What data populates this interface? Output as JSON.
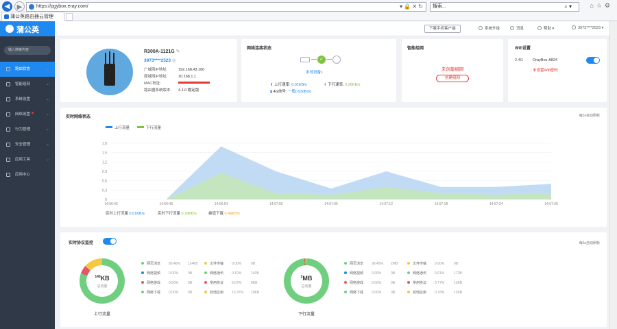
{
  "browser": {
    "url": "https://pgybox.eray.com/",
    "search_placeholder": "搜索...",
    "tab_title": "蒲公英路由器云管理"
  },
  "sidebar": {
    "logo": "蒲公英",
    "search_placeholder": "输入搜索内容",
    "items": [
      {
        "label": "路由状态",
        "active": true
      },
      {
        "label": "智能组网"
      },
      {
        "label": "系统设置"
      },
      {
        "label": "网络设置",
        "dot": true
      },
      {
        "label": "行为管理"
      },
      {
        "label": "安全管理"
      },
      {
        "label": "应用工具"
      },
      {
        "label": "应用中心"
      }
    ]
  },
  "topbar": {
    "download": "下载手机客户端",
    "upgrade": "系统升级",
    "announcement": "消息",
    "help": "帮助",
    "account": "3973****2523"
  },
  "device": {
    "name": "R300A-1121G",
    "account": "3973****2523",
    "rows": [
      {
        "k": "广域网IP地址:",
        "v": "192.168.43.100"
      },
      {
        "k": "局域网IP地址:",
        "v": "10.168.1.1"
      },
      {
        "k": "MAC地址:",
        "v": ""
      },
      {
        "k": "路由器系统版本:",
        "v": "4.1.0 稳定版"
      }
    ]
  },
  "network": {
    "title": "网络连接状态",
    "device_label": "本地设备1",
    "up_label": "上行速率:",
    "up_value": "0.01KB/s",
    "down_label": "下行速率:",
    "down_value": "0.28KB/s",
    "signal_label": "4G信号:",
    "signal_value": "一般(-93dBm)"
  },
  "mesh": {
    "title": "智能组网",
    "status": "未创建组网",
    "button": "创建组网"
  },
  "wifi": {
    "title": "Wifi设置",
    "band": "2.4G",
    "ssid": "OrayBox-A824",
    "warning": "未设置Wifi密码"
  },
  "traffic": {
    "title": "实时网络状态",
    "auto": "每5s自动刷新",
    "legend_up": "上行流量",
    "legend_down": "下行流量",
    "footer_up_label": "实时上行流量",
    "footer_up": "0.01KB/s",
    "footer_down_label": "实时下行流量",
    "footer_down": "0.28KB/s",
    "footer_peak_label": "峰值下载",
    "footer_peak": "0.46KB/s"
  },
  "chart_data": {
    "type": "area",
    "x": [
      "14:56:45",
      "14:56:48",
      "14:56:54",
      "14:57:00",
      "14:57:06",
      "14:57:12",
      "14:57:18",
      "14:57:24",
      "14:57:30"
    ],
    "ylim": [
      0,
      1.8
    ],
    "yticks": [
      0,
      0.3,
      0.6,
      0.9,
      1.2,
      1.5,
      1.8
    ],
    "series": [
      {
        "name": "上行流量",
        "color": "#b7d5f2",
        "values": [
          0,
          0,
          1.7,
          0.9,
          0.35,
          0.9,
          0.4,
          0.4,
          0.5
        ]
      },
      {
        "name": "下行流量",
        "color": "#c6e6b7",
        "values": [
          0,
          0,
          0.85,
          0.2,
          0.15,
          0.4,
          0.2,
          0.15,
          0.2
        ]
      }
    ]
  },
  "protocol": {
    "title": "实时协议监控",
    "auto": "每5s自动刷新",
    "up": {
      "value": "149",
      "unit": "KB",
      "sub": "总流量",
      "label": "上行流量",
      "rows": [
        {
          "n": "网页浏览",
          "p": "80.46%",
          "s": "114KB",
          "c": "#6fcf7f"
        },
        {
          "n": "网络视频",
          "p": "0.00%",
          "s": "0B",
          "c": "#1f89ef"
        },
        {
          "n": "网络游戏",
          "p": "0.00%",
          "s": "0B",
          "c": "#e5556b"
        },
        {
          "n": "网络下载",
          "p": "0.00%",
          "s": "0B",
          "c": "#6fcf7f"
        },
        {
          "n": "文件传输",
          "p": "0.00%",
          "s": "0B",
          "c": "#f5c842"
        },
        {
          "n": "网络通讯",
          "p": "0.10%",
          "s": "140B",
          "c": "#6fcf7f"
        },
        {
          "n": "常用协议",
          "p": "6.07%",
          "s": "9KB",
          "c": "#e5556b"
        },
        {
          "n": "其他应用",
          "p": "13.37%",
          "s": "19KB",
          "c": "#f5c842"
        }
      ]
    },
    "down": {
      "value": "2",
      "unit": "MB",
      "sub": "总流量",
      "label": "下行流量",
      "rows": [
        {
          "n": "网页浏览",
          "p": "98.45%",
          "s": "2MB",
          "c": "#6fcf7f"
        },
        {
          "n": "网络视频",
          "p": "0.00%",
          "s": "0B",
          "c": "#1f89ef"
        },
        {
          "n": "网络游戏",
          "p": "0.00%",
          "s": "0B",
          "c": "#e5556b"
        },
        {
          "n": "网络下载",
          "p": "0.00%",
          "s": "0B",
          "c": "#6fcf7f"
        },
        {
          "n": "文件传输",
          "p": "0.00%",
          "s": "0B",
          "c": "#f5c842"
        },
        {
          "n": "网络通讯",
          "p": "0.01%",
          "s": "172B",
          "c": "#6fcf7f"
        },
        {
          "n": "常用协议",
          "p": "0.77%",
          "s": "13KB",
          "c": "#e5556b"
        },
        {
          "n": "其他应用",
          "p": "0.78%",
          "s": "13KB",
          "c": "#f5c842"
        }
      ]
    }
  }
}
